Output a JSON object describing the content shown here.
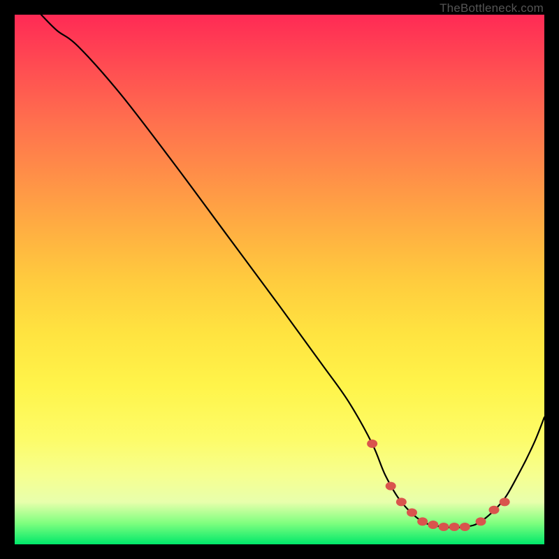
{
  "attribution": "TheBottleneck.com",
  "chart_data": {
    "type": "line",
    "title": "",
    "xlabel": "",
    "ylabel": "",
    "xlim": [
      0,
      100
    ],
    "ylim": [
      0,
      100
    ],
    "series": [
      {
        "name": "curve",
        "x": [
          5,
          8,
          12,
          20,
          30,
          40,
          50,
          58,
          63,
          67.5,
          70,
          73,
          77,
          81,
          85,
          88,
          92,
          95,
          98,
          100
        ],
        "y": [
          100,
          97,
          94,
          85,
          72,
          58.5,
          45,
          34,
          27,
          19,
          13,
          8,
          4.3,
          3.3,
          3.3,
          4.3,
          8,
          13,
          19,
          24
        ]
      },
      {
        "name": "dots",
        "x": [
          67.5,
          71,
          73,
          75,
          77,
          79,
          81,
          83,
          85,
          88,
          90.5,
          92.5
        ],
        "y": [
          19,
          11,
          8,
          6,
          4.3,
          3.7,
          3.3,
          3.3,
          3.3,
          4.3,
          6.5,
          8
        ]
      }
    ],
    "colors": {
      "curve": "#000000",
      "dots": "#d9544d"
    }
  }
}
